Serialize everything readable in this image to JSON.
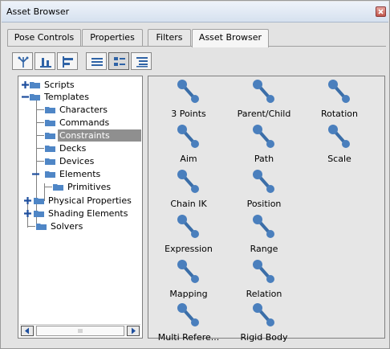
{
  "window": {
    "title": "Asset Browser"
  },
  "tabs": [
    {
      "label": "Pose Controls"
    },
    {
      "label": "Properties"
    },
    {
      "label": "Filters"
    },
    {
      "label": "Asset Browser",
      "active": true
    }
  ],
  "toolbar": {
    "buttons": [
      {
        "icon": "tree-view-icon"
      },
      {
        "icon": "bottom-align-icon"
      },
      {
        "icon": "left-align-icon"
      },
      {
        "icon": "list-view-icon"
      },
      {
        "icon": "icon-view-icon",
        "active": true
      },
      {
        "icon": "detail-view-icon"
      }
    ]
  },
  "tree": {
    "items": [
      {
        "label": "Scripts"
      },
      {
        "label": "Templates"
      },
      {
        "label": "Characters"
      },
      {
        "label": "Commands"
      },
      {
        "label": "Constraints",
        "selected": true
      },
      {
        "label": "Decks"
      },
      {
        "label": "Devices"
      },
      {
        "label": "Elements"
      },
      {
        "label": "Primitives"
      },
      {
        "label": "Physical Properties"
      },
      {
        "label": "Shading Elements"
      },
      {
        "label": "Solvers"
      }
    ]
  },
  "assets": [
    {
      "label": "3 Points"
    },
    {
      "label": "Parent/Child"
    },
    {
      "label": "Rotation"
    },
    {
      "label": "Aim"
    },
    {
      "label": "Path"
    },
    {
      "label": "Scale"
    },
    {
      "label": "Chain IK"
    },
    {
      "label": "Position"
    },
    {
      "label": "Expression"
    },
    {
      "label": "Range"
    },
    {
      "label": "Mapping"
    },
    {
      "label": "Relation"
    },
    {
      "label": "Multi Refere..."
    },
    {
      "label": "Rigid Body"
    }
  ],
  "colors": {
    "accent": "#3b6ea8",
    "folder": "#4f86c6",
    "selection": "#8f8f8f"
  }
}
